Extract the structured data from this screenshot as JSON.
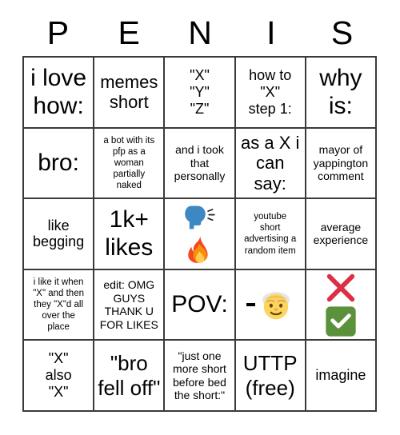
{
  "header": {
    "letters": [
      "P",
      "E",
      "N",
      "I",
      "S"
    ]
  },
  "colors": {
    "grid_line": "#3a3a3a",
    "background": "#ffffff",
    "text": "#000000",
    "emoji_blue": "#3b88c3",
    "emoji_fire_orange": "#f4900c",
    "emoji_fire_red": "#f4481e",
    "emoji_fire_yellow": "#ffcc4d",
    "emoji_skin_yellow": "#fcd462",
    "emoji_hair_grey": "#e6e6e6",
    "cross_red": "#dd2e44",
    "check_green": "#5c913b"
  },
  "grid": {
    "rows": 5,
    "columns": 5,
    "cells": [
      {
        "id": "r1c1",
        "text": "i love\nhow:",
        "size": "fs-xxl",
        "kind": "text"
      },
      {
        "id": "r1c2",
        "text": "memes\nshort",
        "size": "fs-lg",
        "kind": "text"
      },
      {
        "id": "r1c3",
        "text": "\"X\"\n\"Y\"\n\"Z\"",
        "size": "fs-md",
        "kind": "text"
      },
      {
        "id": "r1c4",
        "text": "how to\n\"X\"\nstep 1:",
        "size": "fs-md",
        "kind": "text"
      },
      {
        "id": "r1c5",
        "text": "why\nis:",
        "size": "fs-xxl",
        "kind": "text"
      },
      {
        "id": "r2c1",
        "text": "bro:",
        "size": "fs-xxl",
        "kind": "text"
      },
      {
        "id": "r2c2",
        "text": "a bot with its\npfp as a\nwoman\npartially\nnaked",
        "size": "fs-xs",
        "kind": "text"
      },
      {
        "id": "r2c3",
        "text": "and i took\nthat\npersonally",
        "size": "fs-sm",
        "kind": "text"
      },
      {
        "id": "r2c4",
        "text": "as a X i\ncan\nsay:",
        "size": "fs-lg",
        "kind": "text"
      },
      {
        "id": "r2c5",
        "text": "mayor of\nyappington\ncomment",
        "size": "fs-sm",
        "kind": "text"
      },
      {
        "id": "r3c1",
        "text": "like\nbegging",
        "size": "fs-md",
        "kind": "text"
      },
      {
        "id": "r3c2",
        "text": "1k+\nlikes",
        "size": "fs-xxl",
        "kind": "text"
      },
      {
        "id": "r3c3",
        "text": "",
        "size": "fs-md",
        "kind": "emoji-speak-fire",
        "emoji": [
          "speaking-head-emoji",
          "fire-emoji"
        ]
      },
      {
        "id": "r3c4",
        "text": "youtube\nshort\nadvertising a\nrandom item",
        "size": "fs-xs",
        "kind": "text"
      },
      {
        "id": "r3c5",
        "text": "average\nexperience",
        "size": "fs-sm",
        "kind": "text"
      },
      {
        "id": "r4c1",
        "text": "i like it when\n\"X\" and then\nthey \"X\"d all\nover the\nplace",
        "size": "fs-xs",
        "kind": "text"
      },
      {
        "id": "r4c2",
        "text": "edit: OMG\nGUYS\nTHANK U\nFOR LIKES",
        "size": "fs-sm",
        "kind": "text"
      },
      {
        "id": "r4c3",
        "text": "POV:",
        "size": "fs-xxl",
        "kind": "text"
      },
      {
        "id": "r4c4",
        "text": "-",
        "size": "fs-md",
        "kind": "emoji-dash-oldman",
        "emoji": [
          "old-man-emoji"
        ]
      },
      {
        "id": "r4c5",
        "text": "",
        "size": "fs-md",
        "kind": "emoji-cross-check",
        "emoji": [
          "cross-mark-emoji",
          "check-mark-button-emoji"
        ]
      },
      {
        "id": "r5c1",
        "text": "\"X\"\nalso\n\"X\"",
        "size": "fs-md",
        "kind": "text"
      },
      {
        "id": "r5c2",
        "text": "\"bro\nfell off\"",
        "size": "fs-xl",
        "kind": "text"
      },
      {
        "id": "r5c3",
        "text": "\"just one\nmore short\nbefore bed\nthe short:\"",
        "size": "fs-sm",
        "kind": "text"
      },
      {
        "id": "r5c4",
        "text": "UTTP\n(free)",
        "size": "fs-xl",
        "kind": "text"
      },
      {
        "id": "r5c5",
        "text": "imagine",
        "size": "fs-md",
        "kind": "text"
      }
    ]
  }
}
